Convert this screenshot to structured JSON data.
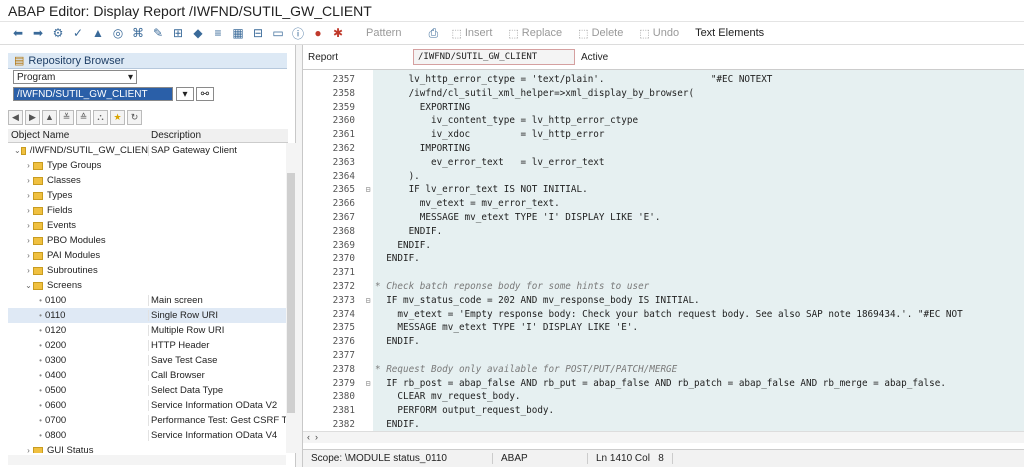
{
  "window": {
    "title": "ABAP Editor: Display Report /IWFND/SUTIL_GW_CLIENT"
  },
  "toolbar": {
    "icons": [
      "back-icon",
      "forward-icon",
      "other-object-icon",
      "check-icon",
      "activate-icon",
      "test-icon",
      "where-used-icon",
      "navigation-icon",
      "insert-icon",
      "enhance-icon",
      "object-list-icon",
      "navigation-tree-icon",
      "hierarchy-icon",
      "window-icon",
      "info-icon",
      "breakpoint-icon",
      "debug-icon"
    ],
    "pattern": "Pattern",
    "insert": "Insert",
    "replace": "Replace",
    "delete": "Delete",
    "undo": "Undo",
    "text_elements": "Text Elements"
  },
  "repo": {
    "header": "Repository Browser",
    "type_select": "Program",
    "object_value": "/IWFND/SUTIL_GW_CLIENT",
    "col_name": "Object Name",
    "col_desc": "Description",
    "tree": [
      {
        "label": "/IWFND/SUTIL_GW_CLIEN",
        "desc": "SAP Gateway Client",
        "kind": "root"
      },
      {
        "label": "Type Groups",
        "desc": "",
        "kind": "folder"
      },
      {
        "label": "Classes",
        "desc": "",
        "kind": "folder"
      },
      {
        "label": "Types",
        "desc": "",
        "kind": "folder"
      },
      {
        "label": "Fields",
        "desc": "",
        "kind": "folder"
      },
      {
        "label": "Events",
        "desc": "",
        "kind": "folder"
      },
      {
        "label": "PBO Modules",
        "desc": "",
        "kind": "folder"
      },
      {
        "label": "PAI Modules",
        "desc": "",
        "kind": "folder"
      },
      {
        "label": "Subroutines",
        "desc": "",
        "kind": "folder"
      },
      {
        "label": "Screens",
        "desc": "",
        "kind": "open"
      },
      {
        "label": "0100",
        "desc": "Main screen",
        "kind": "leaf"
      },
      {
        "label": "0110",
        "desc": "Single Row URI",
        "kind": "leaf"
      },
      {
        "label": "0120",
        "desc": "Multiple Row URI",
        "kind": "leaf"
      },
      {
        "label": "0200",
        "desc": "HTTP Header",
        "kind": "leaf"
      },
      {
        "label": "0300",
        "desc": "Save Test Case",
        "kind": "leaf"
      },
      {
        "label": "0400",
        "desc": "Call Browser",
        "kind": "leaf"
      },
      {
        "label": "0500",
        "desc": "Select Data Type",
        "kind": "leaf"
      },
      {
        "label": "0600",
        "desc": "Service Information OData V2",
        "kind": "leaf"
      },
      {
        "label": "0700",
        "desc": "Performance Test: Gest CSRF To",
        "kind": "leaf"
      },
      {
        "label": "0800",
        "desc": "Service Information OData V4",
        "kind": "leaf"
      },
      {
        "label": "GUI Status",
        "desc": "",
        "kind": "folder"
      }
    ]
  },
  "editor": {
    "report_label": "Report",
    "report_name": "/IWFND/SUTIL_GW_CLIENT",
    "status_label": "Active",
    "lines": [
      {
        "n": "2357",
        "f": "",
        "t": "      lv_http_error_ctype = 'text/plain'.                   \"#EC NOTEXT"
      },
      {
        "n": "2358",
        "f": "",
        "t": "      /iwfnd/cl_sutil_xml_helper=>xml_display_by_browser("
      },
      {
        "n": "2359",
        "f": "",
        "t": "        EXPORTING"
      },
      {
        "n": "2360",
        "f": "",
        "t": "          iv_content_type = lv_http_error_ctype"
      },
      {
        "n": "2361",
        "f": "",
        "t": "          iv_xdoc         = lv_http_error"
      },
      {
        "n": "2362",
        "f": "",
        "t": "        IMPORTING"
      },
      {
        "n": "2363",
        "f": "",
        "t": "          ev_error_text   = lv_error_text"
      },
      {
        "n": "2364",
        "f": "",
        "t": "      )."
      },
      {
        "n": "2365",
        "f": "⊟",
        "t": "      IF lv_error_text IS NOT INITIAL."
      },
      {
        "n": "2366",
        "f": "",
        "t": "        mv_etext = mv_error_text."
      },
      {
        "n": "2367",
        "f": "",
        "t": "        MESSAGE mv_etext TYPE 'I' DISPLAY LIKE 'E'."
      },
      {
        "n": "2368",
        "f": "",
        "t": "      ENDIF."
      },
      {
        "n": "2369",
        "f": "",
        "t": "    ENDIF."
      },
      {
        "n": "2370",
        "f": "",
        "t": "  ENDIF."
      },
      {
        "n": "2371",
        "f": "",
        "t": ""
      },
      {
        "n": "2372",
        "f": "",
        "t": "* Check batch reponse body for some hints to user"
      },
      {
        "n": "2373",
        "f": "⊟",
        "t": "  IF mv_status_code = 202 AND mv_response_body IS INITIAL."
      },
      {
        "n": "2374",
        "f": "",
        "t": "    mv_etext = 'Empty response body: Check your batch request body. See also SAP note 1869434.'. \"#EC NOT"
      },
      {
        "n": "2375",
        "f": "",
        "t": "    MESSAGE mv_etext TYPE 'I' DISPLAY LIKE 'E'."
      },
      {
        "n": "2376",
        "f": "",
        "t": "  ENDIF."
      },
      {
        "n": "2377",
        "f": "",
        "t": ""
      },
      {
        "n": "2378",
        "f": "",
        "t": "* Request Body only available for POST/PUT/PATCH/MERGE"
      },
      {
        "n": "2379",
        "f": "⊟",
        "t": "  IF rb_post = abap_false AND rb_put = abap_false AND rb_patch = abap_false AND rb_merge = abap_false."
      },
      {
        "n": "2380",
        "f": "",
        "t": "    CLEAR mv_request_body."
      },
      {
        "n": "2381",
        "f": "",
        "t": "    PERFORM output_request_body."
      },
      {
        "n": "2382",
        "f": "",
        "t": "  ENDIF."
      }
    ]
  },
  "status": {
    "scope": "Scope: \\MODULE status_0110",
    "lang": "ABAP",
    "pos": "Ln 1410 Col   8"
  }
}
